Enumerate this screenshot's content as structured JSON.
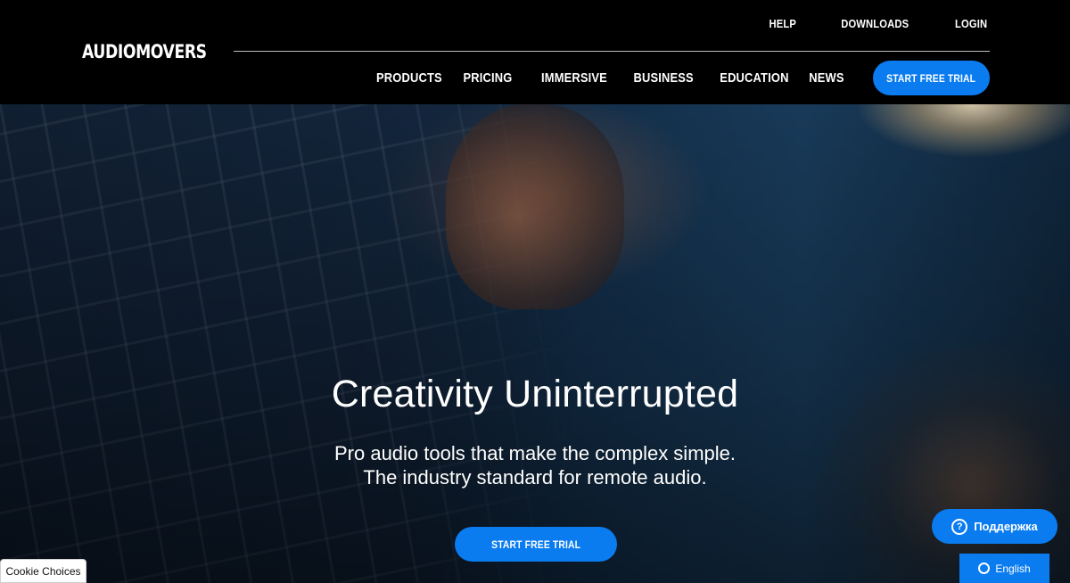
{
  "header": {
    "logo": "AUDIOMOVERS",
    "top_links": [
      "HELP",
      "DOWNLOADS",
      "LOGIN"
    ],
    "nav": [
      "PRODUCTS",
      "PRICING",
      "IMMERSIVE",
      "BUSINESS",
      "EDUCATION",
      "NEWS"
    ],
    "cta_label": "START FREE TRIAL"
  },
  "hero": {
    "title": "Creativity Uninterrupted",
    "subtitle_line1": "Pro audio tools that make the complex simple.",
    "subtitle_line2": "The industry standard for remote audio.",
    "cta_label": "START FREE TRIAL"
  },
  "widgets": {
    "cookie_label": "Cookie Choices",
    "support_label": "Поддержка",
    "language_label": "English"
  },
  "colors": {
    "accent": "#0a7cf0",
    "header_bg": "#000000"
  }
}
